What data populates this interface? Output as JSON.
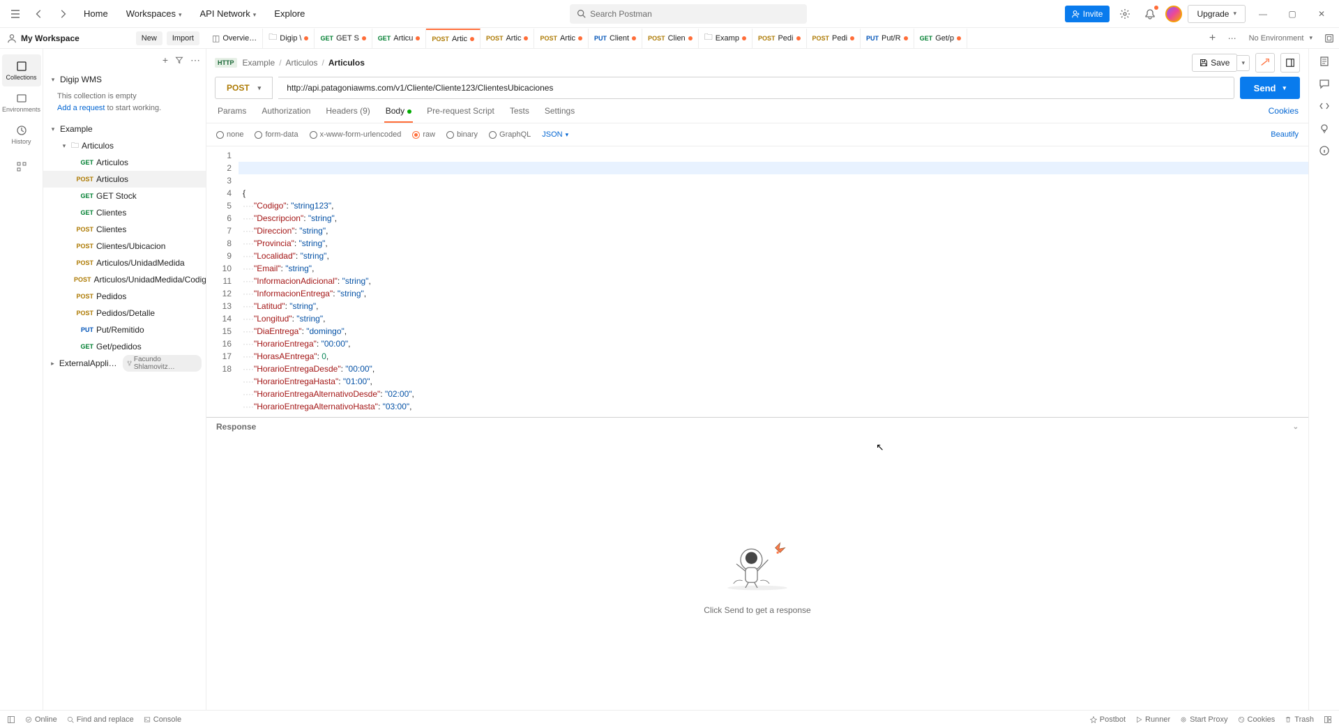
{
  "topbar": {
    "home": "Home",
    "workspaces": "Workspaces",
    "api_network": "API Network",
    "explore": "Explore",
    "search_placeholder": "Search Postman",
    "invite": "Invite",
    "upgrade": "Upgrade"
  },
  "workspace": {
    "title": "My Workspace",
    "new_btn": "New",
    "import_btn": "Import",
    "no_env": "No Environment"
  },
  "tabs": [
    {
      "icon": "overview",
      "label": "Overvie…",
      "method": "",
      "dirty": false
    },
    {
      "icon": "folder",
      "label": "Digip \\",
      "method": "",
      "dirty": true
    },
    {
      "icon": "",
      "label": "GET S",
      "method": "GET",
      "dirty": true
    },
    {
      "icon": "",
      "label": "Articu",
      "method": "GET",
      "dirty": true
    },
    {
      "icon": "",
      "label": "Artic",
      "method": "POST",
      "dirty": true,
      "active": true
    },
    {
      "icon": "",
      "label": "Artic",
      "method": "POST",
      "dirty": true
    },
    {
      "icon": "",
      "label": "Artic",
      "method": "POST",
      "dirty": true
    },
    {
      "icon": "",
      "label": "Client",
      "method": "PUT",
      "dirty": true
    },
    {
      "icon": "",
      "label": "Clien",
      "method": "POST",
      "dirty": true
    },
    {
      "icon": "folder",
      "label": "Examp",
      "method": "",
      "dirty": true
    },
    {
      "icon": "",
      "label": "Pedi",
      "method": "POST",
      "dirty": true
    },
    {
      "icon": "",
      "label": "Pedi",
      "method": "POST",
      "dirty": true
    },
    {
      "icon": "",
      "label": "Put/R",
      "method": "PUT",
      "dirty": true
    },
    {
      "icon": "",
      "label": "Get/p",
      "method": "GET",
      "dirty": true
    }
  ],
  "rail": {
    "collections": "Collections",
    "environments": "Environments",
    "history": "History"
  },
  "sidebar": {
    "c0": {
      "name": "Digip WMS"
    },
    "hint_empty": "This collection is empty",
    "hint_add": "Add a request",
    "hint_rest": " to start working.",
    "c1": {
      "name": "Example"
    },
    "folder": {
      "name": "Articulos"
    },
    "items": [
      {
        "method": "GET",
        "label": "Articulos"
      },
      {
        "method": "POST",
        "label": "Articulos",
        "sel": true
      },
      {
        "method": "GET",
        "label": "GET Stock"
      },
      {
        "method": "GET",
        "label": "Clientes"
      },
      {
        "method": "POST",
        "label": "Clientes"
      },
      {
        "method": "POST",
        "label": "Clientes/Ubicacion"
      },
      {
        "method": "POST",
        "label": "Articulos/UnidadMedida"
      },
      {
        "method": "POST",
        "label": "Articulos/UnidadMedida/Codig…"
      },
      {
        "method": "POST",
        "label": "Pedidos"
      },
      {
        "method": "POST",
        "label": "Pedidos/Detalle"
      },
      {
        "method": "PUT",
        "label": "Put/Remitido"
      },
      {
        "method": "GET",
        "label": "Get/pedidos"
      }
    ],
    "c2": {
      "name": "ExternalAppli…",
      "fork": "Facundo Shlamovitz…"
    }
  },
  "breadcrumbs": {
    "badge": "HTTP",
    "p0": "Example",
    "p1": "Articulos",
    "p2": "Articulos",
    "save": "Save"
  },
  "request": {
    "method": "POST",
    "url": "http://api.patagoniawms.com/v1/Cliente/Cliente123/ClientesUbicaciones",
    "send": "Send"
  },
  "reqtabs": {
    "params": "Params",
    "auth": "Authorization",
    "headers": "Headers (9)",
    "body": "Body",
    "prereq": "Pre-request Script",
    "tests": "Tests",
    "settings": "Settings",
    "cookies": "Cookies"
  },
  "bodyopts": {
    "none": "none",
    "formdata": "form-data",
    "urlencoded": "x-www-form-urlencoded",
    "raw": "raw",
    "binary": "binary",
    "graphql": "GraphQL",
    "json": "JSON",
    "beautify": "Beautify"
  },
  "editor": {
    "lines": [
      {
        "n": "1",
        "t": "{"
      },
      {
        "n": "2",
        "t": "    \"Codigo\": \"string123\","
      },
      {
        "n": "3",
        "t": "    \"Descripcion\": \"string\","
      },
      {
        "n": "4",
        "t": "    \"Direccion\": \"string\","
      },
      {
        "n": "5",
        "t": "    \"Provincia\": \"string\","
      },
      {
        "n": "6",
        "t": "    \"Localidad\": \"string\","
      },
      {
        "n": "7",
        "t": "    \"Email\": \"string\","
      },
      {
        "n": "8",
        "t": "    \"InformacionAdicional\": \"string\","
      },
      {
        "n": "9",
        "t": "    \"InformacionEntrega\": \"string\","
      },
      {
        "n": "10",
        "t": "    \"Latitud\": \"string\","
      },
      {
        "n": "11",
        "t": "    \"Longitud\": \"string\","
      },
      {
        "n": "12",
        "t": "    \"DiaEntrega\": \"domingo\","
      },
      {
        "n": "13",
        "t": "    \"HorarioEntrega\": \"00:00\","
      },
      {
        "n": "14",
        "t": "    \"HorasAEntrega\": 0,"
      },
      {
        "n": "15",
        "t": "    \"HorarioEntregaDesde\": \"00:00\","
      },
      {
        "n": "16",
        "t": "    \"HorarioEntregaHasta\": \"01:00\","
      },
      {
        "n": "17",
        "t": "    \"HorarioEntregaAlternativoDesde\": \"02:00\","
      },
      {
        "n": "18",
        "t": "    \"HorarioEntregaAlternativoHasta\": \"03:00\","
      }
    ]
  },
  "response": {
    "title": "Response",
    "empty": "Click Send to get a response"
  },
  "status": {
    "online": "Online",
    "find": "Find and replace",
    "console": "Console",
    "postbot": "Postbot",
    "runner": "Runner",
    "proxy": "Start Proxy",
    "cookies": "Cookies",
    "trash": "Trash"
  }
}
